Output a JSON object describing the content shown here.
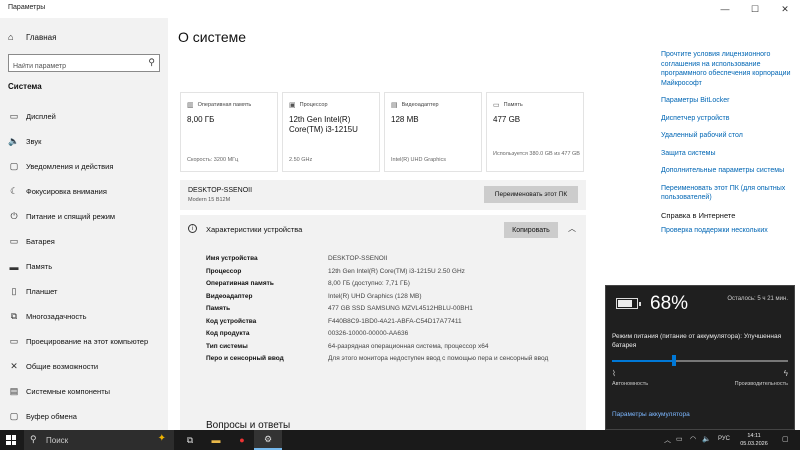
{
  "window": {
    "title": "Параметры",
    "controls": [
      "—",
      "☐",
      "✕"
    ]
  },
  "sidebar": {
    "home_label": "Главная",
    "search_placeholder": "Найти параметр",
    "section_title": "Система",
    "items": [
      {
        "label": "Дисплей",
        "icon": "display-icon",
        "glyph": "▭"
      },
      {
        "label": "Звук",
        "icon": "sound-icon",
        "glyph": "🔈"
      },
      {
        "label": "Уведомления и действия",
        "icon": "notifications-icon",
        "glyph": "▢"
      },
      {
        "label": "Фокусировка внимания",
        "icon": "focus-assist-icon",
        "glyph": "☾"
      },
      {
        "label": "Питание и спящий режим",
        "icon": "power-icon",
        "glyph": "⏻"
      },
      {
        "label": "Батарея",
        "icon": "battery-icon",
        "glyph": "▭"
      },
      {
        "label": "Память",
        "icon": "storage-icon",
        "glyph": "▬"
      },
      {
        "label": "Планшет",
        "icon": "tablet-icon",
        "glyph": "▯"
      },
      {
        "label": "Многозадачность",
        "icon": "multitasking-icon",
        "glyph": "⧉"
      },
      {
        "label": "Проецирование на этот компьютер",
        "icon": "projecting-icon",
        "glyph": "▭"
      },
      {
        "label": "Общие возможности",
        "icon": "shared-experiences-icon",
        "glyph": "✕"
      },
      {
        "label": "Системные компоненты",
        "icon": "system-components-icon",
        "glyph": "▤"
      },
      {
        "label": "Буфер обмена",
        "icon": "clipboard-icon",
        "glyph": "▢"
      }
    ]
  },
  "main": {
    "title": "О системе",
    "cards": [
      {
        "header": "Оперативная память",
        "icon": "ram-icon",
        "glyph": "▥",
        "value": "8,00 ГБ",
        "sub": "Скорость: 3200 МГц"
      },
      {
        "header": "Процессор",
        "icon": "cpu-icon",
        "glyph": "▣",
        "value": "12th Gen Intel(R) Core(TM) i3-1215U",
        "sub": "2.50 GHz"
      },
      {
        "header": "Видеоадаптер",
        "icon": "gpu-icon",
        "glyph": "▤",
        "value": "128 MB",
        "sub": "Intel(R) UHD Graphics"
      },
      {
        "header": "Память",
        "icon": "disk-icon",
        "glyph": "▭",
        "value": "477 GB",
        "sub": "Используется 380.0 GB из 477 GB"
      }
    ],
    "device": {
      "name": "DESKTOP-SSENOII",
      "model": "Modern 15 B12M",
      "rename_button": "Переименовать этот ПК"
    },
    "specs": {
      "title": "Характеристики устройства",
      "copy_button": "Копировать",
      "rows": [
        {
          "key": "Имя устройства",
          "value": "DESKTOP-SSENOII"
        },
        {
          "key": "Процессор",
          "value": "12th Gen Intel(R) Core(TM) i3-1215U   2.50 GHz"
        },
        {
          "key": "Оперативная память",
          "value": "8,00 ГБ (доступно: 7,71 ГБ)"
        },
        {
          "key": "Видеоадаптер",
          "value": "Intel(R) UHD Graphics (128 MB)"
        },
        {
          "key": "Память",
          "value": "477 GB SSD SAMSUNG MZVL4512HBLU-00BH1"
        },
        {
          "key": "Код устройства",
          "value": "F440B8C9-1BD0-4A21-ABFA-C54D17A77411"
        },
        {
          "key": "Код продукта",
          "value": "00326-10000-00000-AA636"
        },
        {
          "key": "Тип системы",
          "value": "64-разрядная операционная система, процессор x64"
        },
        {
          "key": "Перо и сенсорный ввод",
          "value": "Для этого монитора недоступен ввод с помощью пера и сенсорный ввод"
        }
      ]
    },
    "qa_title": "Вопросы и ответы"
  },
  "related": {
    "links": [
      "Прочтите условия лицензионного соглашения на использование программного обеспечения корпорации Майкрософт",
      "Параметры BitLocker",
      "Диспетчер устройств",
      "Удаленный рабочий стол",
      "Защита системы",
      "Дополнительные параметры системы",
      "Переименовать этот ПК (для опытных пользователей)"
    ],
    "help_header": "Справка в Интернете",
    "help_link": "Проверка поддержки нескольких"
  },
  "battery": {
    "percent": "68%",
    "level": 0.68,
    "remaining": "Осталось: 5 ч 21 мин.",
    "power_mode": "Режим питания (питание от аккумулятора): Улучшенная батарея",
    "slider_position": 0.35,
    "left_label": "Автономность",
    "right_label": "Производительность",
    "settings_link": "Параметры аккумулятора"
  },
  "taskbar": {
    "search_label": "Поиск",
    "lang": "РУС",
    "time": "14:11",
    "date": "05.03.2026"
  },
  "colors": {
    "accent": "#0078d7",
    "link": "#0066b4",
    "sidebar_bg": "#f2f2f2"
  }
}
